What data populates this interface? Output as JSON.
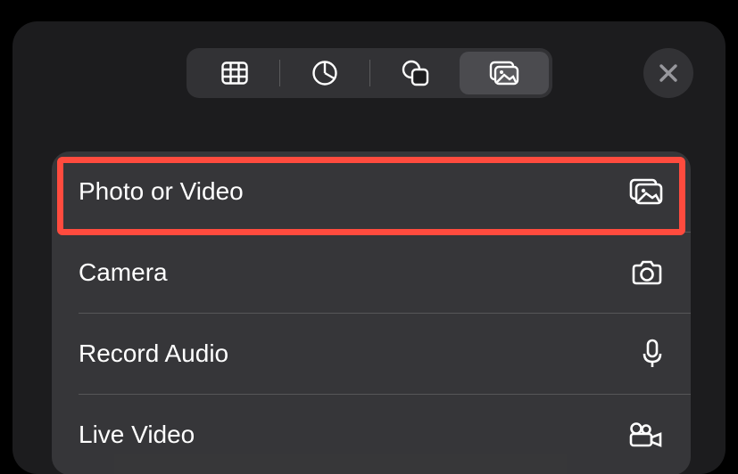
{
  "toolbar": {
    "tabs": [
      {
        "name": "table-icon"
      },
      {
        "name": "pie-chart-icon"
      },
      {
        "name": "shapes-icon"
      },
      {
        "name": "media-icon"
      }
    ],
    "active_index": 3,
    "close_label": "Close"
  },
  "menu": {
    "items": [
      {
        "label": "Photo or Video",
        "icon": "media-gallery-icon"
      },
      {
        "label": "Camera",
        "icon": "camera-icon"
      },
      {
        "label": "Record Audio",
        "icon": "microphone-icon"
      },
      {
        "label": "Live Video",
        "icon": "video-camera-icon"
      }
    ]
  },
  "highlight_color": "#ff4b3e"
}
